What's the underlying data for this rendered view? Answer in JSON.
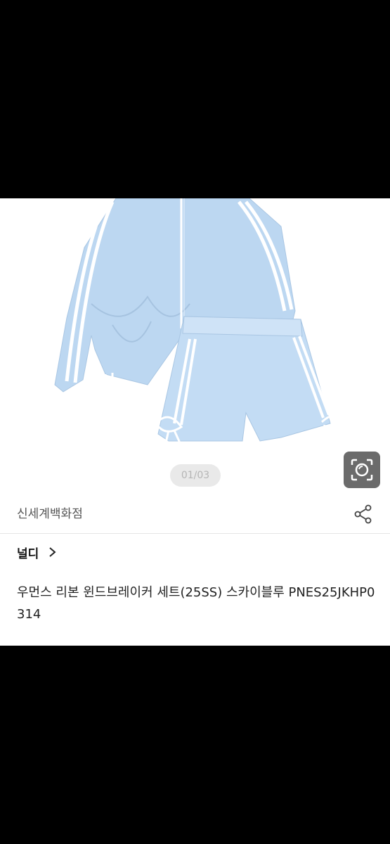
{
  "gallery": {
    "counter": "01/03",
    "lens_icon": "camera-lens-icon"
  },
  "store": {
    "name": "신세계백화점",
    "share_icon": "share-icon"
  },
  "brand": {
    "name": "널디",
    "chevron_icon": "chevron-right-icon"
  },
  "product": {
    "title": "우먼스 리본 윈드브레이커 세트(25SS) 스카이블루 PNES25JKHP0314",
    "product_color": "#b9d6f2"
  }
}
